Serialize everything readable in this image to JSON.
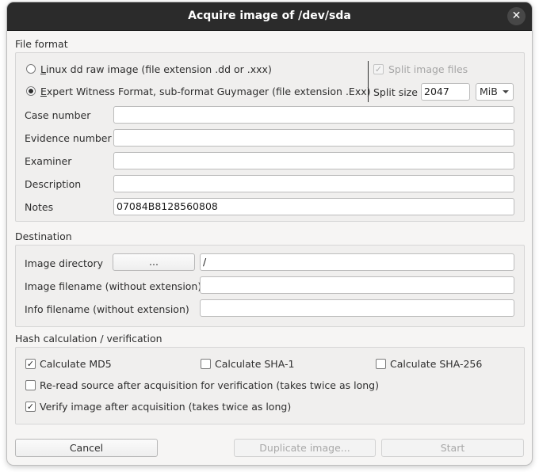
{
  "window": {
    "title": "Acquire image of /dev/sda",
    "close_glyph": "✕"
  },
  "file_format": {
    "section_label": "File format",
    "option_dd": {
      "label_mnemonic": "L",
      "label_rest": "inux dd raw image (file extension .dd or .xxx)",
      "selected": false
    },
    "option_ewf": {
      "label_mnemonic": "E",
      "label_rest": "xpert Witness Format, sub-format Guymager (file extension .Exx)",
      "selected": true
    },
    "split_image_files": {
      "label": "Split image files",
      "checked": true,
      "enabled": false
    },
    "split_size": {
      "label": "Split size",
      "value": "2047",
      "unit": "MiB"
    },
    "fields": [
      {
        "label": "Case number",
        "value": ""
      },
      {
        "label": "Evidence number",
        "value": ""
      },
      {
        "label": "Examiner",
        "value": ""
      },
      {
        "label": "Description",
        "value": ""
      },
      {
        "label": "Notes",
        "value": "07084B8128560808"
      }
    ]
  },
  "destination": {
    "section_label": "Destination",
    "image_directory": {
      "label": "Image directory",
      "browse_label": "...",
      "value": "/"
    },
    "image_filename": {
      "label": "Image filename (without extension)",
      "value": ""
    },
    "info_filename": {
      "label": "Info filename (without extension)",
      "value": ""
    }
  },
  "hash": {
    "section_label": "Hash calculation / verification",
    "md5": {
      "label": "Calculate MD5",
      "checked": true
    },
    "sha1": {
      "label": "Calculate SHA-1",
      "checked": false
    },
    "sha256": {
      "label": "Calculate SHA-256",
      "checked": false
    },
    "reread": {
      "label": "Re-read source after acquisition for verification (takes twice as long)",
      "checked": false
    },
    "verify": {
      "label": "Verify image after acquisition (takes twice as long)",
      "checked": true
    }
  },
  "buttons": {
    "cancel": "Cancel",
    "duplicate": "Duplicate image...",
    "start": "Start"
  },
  "check_glyph": "✓"
}
